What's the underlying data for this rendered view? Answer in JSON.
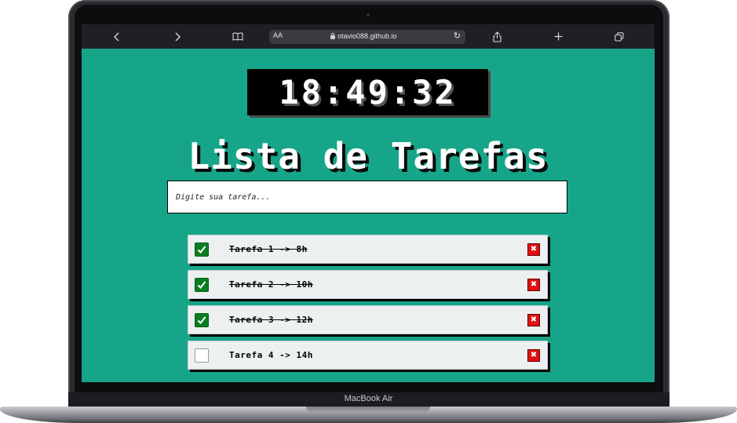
{
  "device": {
    "label": "MacBook Air"
  },
  "browser": {
    "aa_label": "AA",
    "url": "otavio088.github.io",
    "icons": {
      "back": "chevron-left-icon",
      "forward": "chevron-right-icon",
      "bookmarks": "book-icon",
      "reload": "reload-icon",
      "share": "share-icon",
      "new_tab": "plus-icon",
      "tabs": "tabs-icon"
    }
  },
  "page": {
    "clock": "18:49:32",
    "title": "Lista de Tarefas",
    "input_placeholder": "Digite sua tarefa...",
    "tasks": [
      {
        "text": "Tarefa 1 -> 8h",
        "done": true
      },
      {
        "text": "Tarefa 2 -> 10h",
        "done": true
      },
      {
        "text": "Tarefa 3 -> 12h",
        "done": true
      },
      {
        "text": "Tarefa 4 -> 14h",
        "done": false
      }
    ],
    "delete_glyph": "✖"
  },
  "colors": {
    "page_background": "#17a589",
    "check_done": "#0a7d21",
    "delete_button": "#e01010"
  }
}
